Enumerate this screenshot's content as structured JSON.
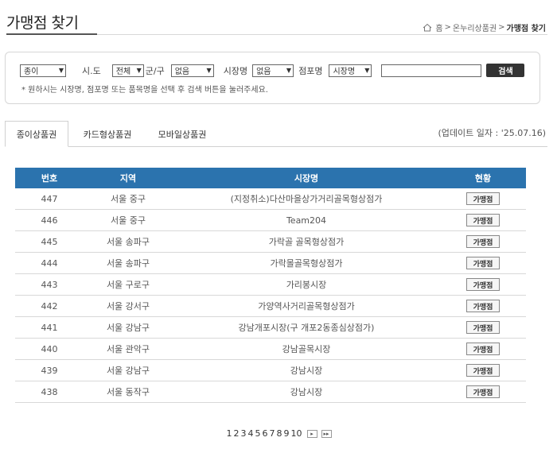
{
  "header": {
    "title": "가맹점 찾기",
    "breadcrumb": {
      "home": "홈",
      "section": "온누리상품권",
      "current": "가맹점 찾기",
      "sep": ">"
    }
  },
  "search": {
    "type_select": "종이",
    "sido_label": "시.도",
    "sido_select": "전체",
    "gungu_label": "군/구",
    "gungu_select": "없음",
    "market_label": "시장명",
    "market_select": "없음",
    "store_label": "점포명",
    "store_select": "시장명",
    "input_value": "",
    "button_label": "검색",
    "hint": "* 원하시는 시장명, 점포명 또는 품목명을 선택 후 검색 버튼을 눌러주세요."
  },
  "tabs": [
    {
      "label": "종이상품권"
    },
    {
      "label": "카드형상품권"
    },
    {
      "label": "모바일상품권"
    }
  ],
  "update_date": "(업데이트 일자 : '25.07.16)",
  "table": {
    "headers": [
      "번호",
      "지역",
      "시장명",
      "현황"
    ],
    "rows": [
      {
        "no": "447",
        "region": "서울 중구",
        "market": "(지정취소)다산마을상가거리골목형상점가",
        "status": "가맹점"
      },
      {
        "no": "446",
        "region": "서울 중구",
        "market": "Team204",
        "status": "가맹점"
      },
      {
        "no": "445",
        "region": "서울 송파구",
        "market": "가락골 골목형상점가",
        "status": "가맹점"
      },
      {
        "no": "444",
        "region": "서울 송파구",
        "market": "가락몰골목형상점가",
        "status": "가맹점"
      },
      {
        "no": "443",
        "region": "서울 구로구",
        "market": "가리봉시장",
        "status": "가맹점"
      },
      {
        "no": "442",
        "region": "서울 강서구",
        "market": "가양역사거리골목형상점가",
        "status": "가맹점"
      },
      {
        "no": "441",
        "region": "서울 강남구",
        "market": "강남개포시장(구 개포2동종심상점가)",
        "status": "가맹점"
      },
      {
        "no": "440",
        "region": "서울 관악구",
        "market": "강남골목시장",
        "status": "가맹점"
      },
      {
        "no": "439",
        "region": "서울 강남구",
        "market": "강남시장",
        "status": "가맹점"
      },
      {
        "no": "438",
        "region": "서울 동작구",
        "market": "강남시장",
        "status": "가맹점"
      }
    ]
  },
  "pagination": {
    "pages": [
      "1",
      "2",
      "3",
      "4",
      "5",
      "6",
      "7",
      "8",
      "9",
      "10"
    ],
    "next": "▸",
    "last": "▸▸"
  }
}
